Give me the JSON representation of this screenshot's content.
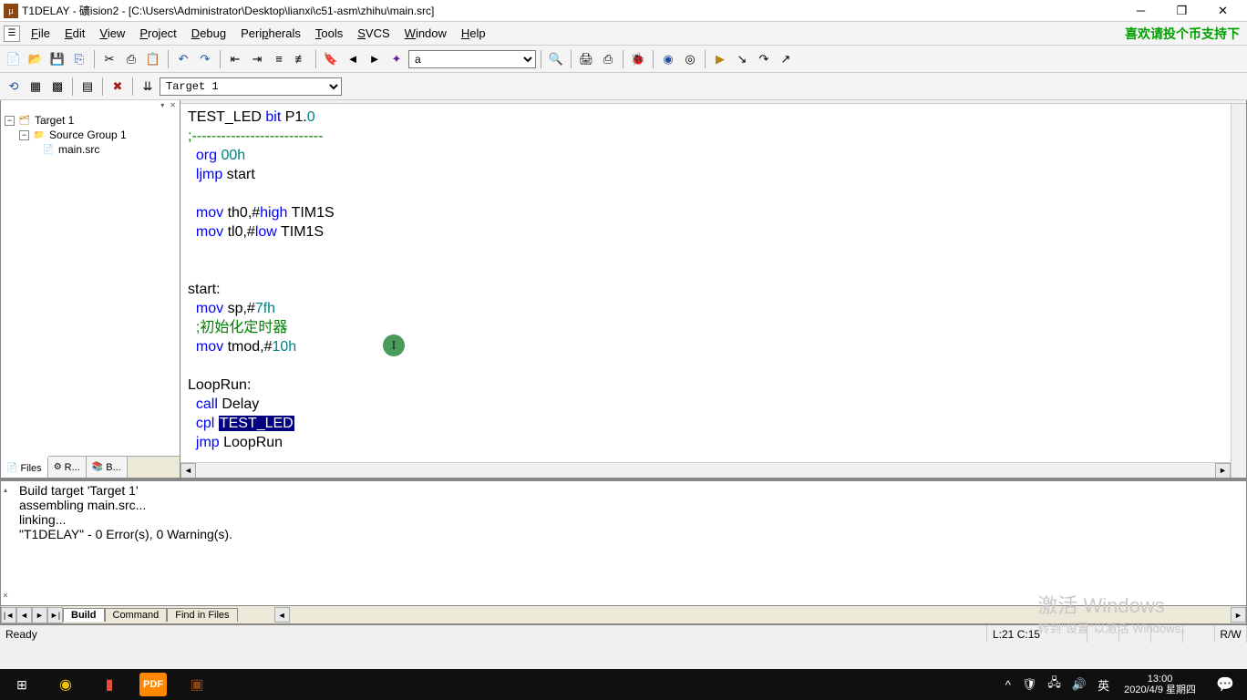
{
  "title": "T1DELAY  - 礦ision2 - [C:\\Users\\Administrator\\Desktop\\lianxi\\c51-asm\\zhihu\\main.src]",
  "promo": "喜欢请投个币支持下",
  "menu": {
    "file": "File",
    "edit": "Edit",
    "view": "View",
    "project": "Project",
    "debug": "Debug",
    "peripherals": "Peripherals",
    "tools": "Tools",
    "svcs": "SVCS",
    "window": "Window",
    "help": "Help"
  },
  "toolbar2": {
    "target_combo": "Target 1"
  },
  "tree": {
    "root": "Target 1",
    "group": "Source Group 1",
    "file": "main.src"
  },
  "proj_tabs": {
    "files": "Files",
    "regs": "R...",
    "books": "B..."
  },
  "code": {
    "l1a": "TEST_LED ",
    "l1b": "bit",
    "l1c": " P1.",
    "l1d": "0",
    "l2": ";---------------------------",
    "l3a": "  ",
    "l3b": "org",
    "l3c": " ",
    "l3d": "00h",
    "l4a": "  ",
    "l4b": "ljmp",
    "l4c": " start",
    "l6a": "  ",
    "l6b": "mov",
    "l6c": " th0,#",
    "l6d": "high",
    "l6e": " TIM1S",
    "l7a": "  ",
    "l7b": "mov",
    "l7c": " tl0,#",
    "l7d": "low",
    "l7e": " TIM1S",
    "l9": "start:",
    "l10a": "  ",
    "l10b": "mov",
    "l10c": " sp,#",
    "l10d": "7fh",
    "l11": "  ;初始化定时器",
    "l12a": "  ",
    "l12b": "mov",
    "l12c": " tmod,#",
    "l12d": "10h",
    "l14": "LoopRun:",
    "l15a": "  ",
    "l15b": "call",
    "l15c": " Delay",
    "l16a": "  ",
    "l16b": "cpl",
    "l16c": " ",
    "l16d": "TEST_LED",
    "l17a": "  ",
    "l17b": "jmp",
    "l17c": " LoopRun"
  },
  "output": {
    "l1": "Build target 'Target 1'",
    "l2": "assembling main.src...",
    "l3": "linking...",
    "l4": "\"T1DELAY\" - 0 Error(s), 0 Warning(s)."
  },
  "out_tabs": {
    "build": "Build",
    "command": "Command",
    "find": "Find in Files"
  },
  "status": {
    "ready": "Ready",
    "pos": "L:21 C:15",
    "rw": "R/W"
  },
  "watermark": {
    "main": "激活 Windows",
    "sub": "转到\"设置\"以激活 Windows。"
  },
  "taskbar": {
    "ime": "英",
    "time": "13:00",
    "date": "2020/4/9 星期四"
  }
}
